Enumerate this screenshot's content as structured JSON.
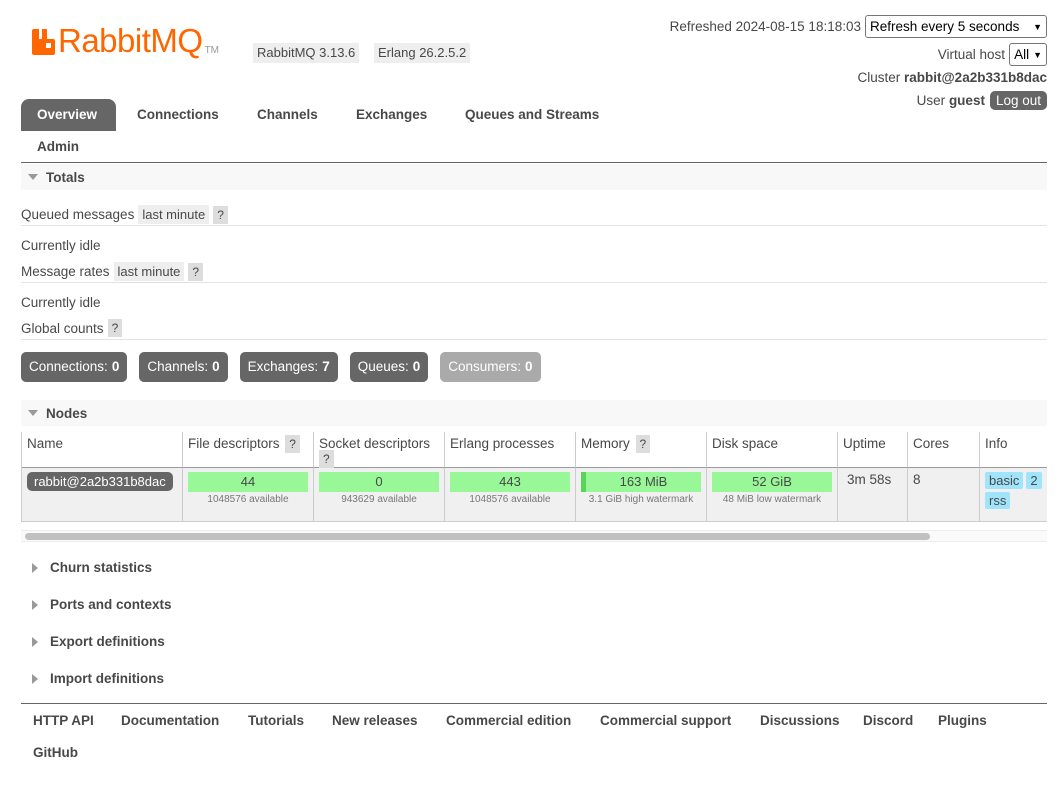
{
  "header": {
    "logo_text": "RabbitMQ",
    "logo_tm": "TM",
    "rabbitmq_version": "RabbitMQ 3.13.6",
    "erlang_version": "Erlang 26.2.5.2",
    "refreshed_label": "Refreshed 2024-08-15 18:18:03",
    "refresh_select": "Refresh every 5 seconds",
    "vhost_label": "Virtual host",
    "vhost_select": "All",
    "cluster_label": "Cluster",
    "cluster_name": "rabbit@2a2b331b8dac",
    "user_label": "User",
    "user_name": "guest",
    "logout": "Log out"
  },
  "tabs": [
    "Overview",
    "Connections",
    "Channels",
    "Exchanges",
    "Queues and Streams",
    "Admin"
  ],
  "totals": {
    "title": "Totals",
    "queued_label": "Queued messages",
    "queued_range": "last minute",
    "help": "?",
    "idle1": "Currently idle",
    "rates_label": "Message rates",
    "rates_range": "last minute",
    "idle2": "Currently idle",
    "global_label": "Global counts"
  },
  "counts": {
    "connections_label": "Connections:",
    "connections": "0",
    "channels_label": "Channels:",
    "channels": "0",
    "exchanges_label": "Exchanges:",
    "exchanges": "7",
    "queues_label": "Queues:",
    "queues": "0",
    "consumers_label": "Consumers:",
    "consumers": "0"
  },
  "nodes": {
    "title": "Nodes",
    "headers": {
      "name": "Name",
      "file_descriptors": "File descriptors",
      "socket_descriptors": "Socket descriptors",
      "erlang_processes": "Erlang processes",
      "memory": "Memory",
      "disk_space": "Disk space",
      "uptime": "Uptime",
      "cores": "Cores",
      "info": "Info"
    },
    "row": {
      "name": "rabbit@2a2b331b8dac",
      "file_descriptors": "44",
      "file_descriptors_sub": "1048576 available",
      "socket_descriptors": "0",
      "socket_descriptors_sub": "943629 available",
      "erlang_processes": "443",
      "erlang_processes_sub": "1048576 available",
      "memory": "163 MiB",
      "memory_sub": "3.1 GiB high watermark",
      "disk_space": "52 GiB",
      "disk_space_sub": "48 MiB low watermark",
      "uptime": "3m 58s",
      "cores": "8",
      "info_tags": [
        "basic",
        "2",
        "rss"
      ]
    }
  },
  "sections": [
    "Churn statistics",
    "Ports and contexts",
    "Export definitions",
    "Import definitions"
  ],
  "footer": [
    "HTTP API",
    "Documentation",
    "Tutorials",
    "New releases",
    "Commercial edition",
    "Commercial support",
    "Discussions",
    "Discord",
    "Plugins",
    "GitHub"
  ]
}
